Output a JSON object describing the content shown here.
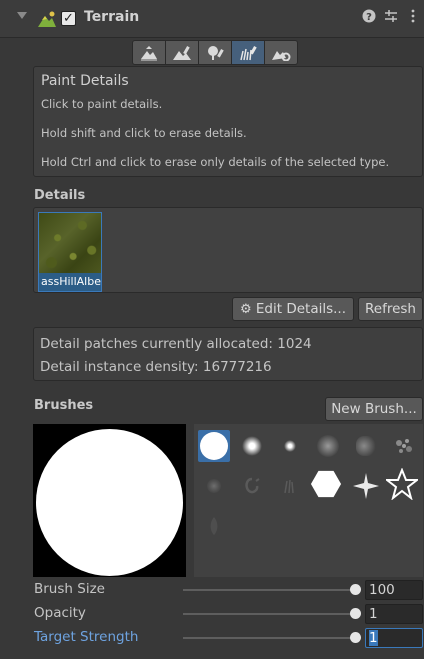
{
  "header": {
    "title": "Terrain",
    "enabled": true,
    "icons": [
      "help-icon",
      "preset-icon",
      "more-menu-icon"
    ]
  },
  "toolbar": {
    "tools": [
      {
        "name": "raise-lower-terrain",
        "active": false
      },
      {
        "name": "paint-texture",
        "active": false
      },
      {
        "name": "paint-trees",
        "active": false
      },
      {
        "name": "paint-details",
        "active": true
      },
      {
        "name": "terrain-settings",
        "active": false
      }
    ],
    "active_color": "#46607c"
  },
  "help": {
    "title": "Paint Details",
    "lines": [
      "Click to paint details.",
      "Hold shift and click to erase details.",
      "Hold Ctrl and click to erase only details of the selected type."
    ]
  },
  "details": {
    "label": "Details",
    "items": [
      {
        "name": "GrassHillAlbedo",
        "shown_label": "assHillAlbe",
        "selected": true
      }
    ],
    "edit_button": "Edit Details...",
    "refresh_button": "Refresh"
  },
  "info": {
    "patches": "Detail patches currently allocated: 1024",
    "density": "Detail instance density: 16777216"
  },
  "brushes": {
    "label": "Brushes",
    "new_button": "New Brush...",
    "selected_index": 0
  },
  "properties": [
    {
      "label": "Brush Size",
      "value": "100",
      "fraction": 1.0,
      "focused": false
    },
    {
      "label": "Opacity",
      "value": "1",
      "fraction": 1.0,
      "focused": false
    },
    {
      "label": "Target Strength",
      "value": "1",
      "fraction": 1.0,
      "focused": true
    }
  ],
  "colors": {
    "accent": "#3a79bb",
    "focus_label": "#6ea3e0",
    "panel": "#383838"
  }
}
